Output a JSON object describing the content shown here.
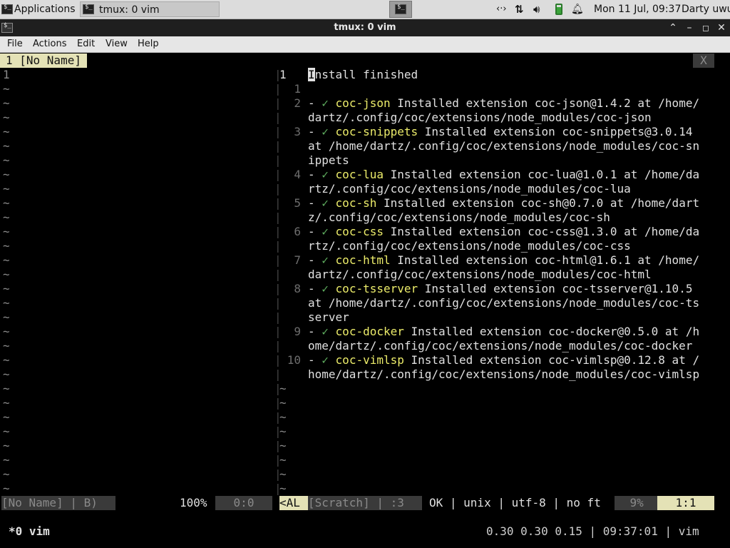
{
  "panel": {
    "apps_label": "Applications",
    "task_label": "tmux: 0 vim",
    "datetime": "Mon 11 Jul, 09:37",
    "user": "Darty uwu"
  },
  "window": {
    "title": "tmux: 0 vim"
  },
  "menu": [
    "File",
    "Actions",
    "Edit",
    "View",
    "Help"
  ],
  "vim": {
    "tab_label": "1 [No Name]",
    "tab_close": "X",
    "left_line": "1",
    "right_first_num": "1",
    "right_first_text": "Install finished",
    "right_second_num": "1",
    "entries": [
      {
        "num": "2",
        "name": "coc-json",
        "rest": " Installed extension coc-json@1.4.2 at /home/",
        "wrap": [
          "dartz/.config/coc/extensions/node_modules/coc-json"
        ]
      },
      {
        "num": "3",
        "name": "coc-snippets",
        "rest": " Installed extension coc-snippets@3.0.14",
        "wrap": [
          "at /home/dartz/.config/coc/extensions/node_modules/coc-sn",
          "ippets"
        ]
      },
      {
        "num": "4",
        "name": "coc-lua",
        "rest": " Installed extension coc-lua@1.0.1 at /home/da",
        "wrap": [
          "rtz/.config/coc/extensions/node_modules/coc-lua"
        ]
      },
      {
        "num": "5",
        "name": "coc-sh",
        "rest": " Installed extension coc-sh@0.7.0 at /home/dart",
        "wrap": [
          "z/.config/coc/extensions/node_modules/coc-sh"
        ]
      },
      {
        "num": "6",
        "name": "coc-css",
        "rest": " Installed extension coc-css@1.3.0 at /home/da",
        "wrap": [
          "rtz/.config/coc/extensions/node_modules/coc-css"
        ]
      },
      {
        "num": "7",
        "name": "coc-html",
        "rest": " Installed extension coc-html@1.6.1 at /home/",
        "wrap": [
          "dartz/.config/coc/extensions/node_modules/coc-html"
        ]
      },
      {
        "num": "8",
        "name": "coc-tsserver",
        "rest": " Installed extension coc-tsserver@1.10.5",
        "wrap": [
          "at /home/dartz/.config/coc/extensions/node_modules/coc-ts",
          "server"
        ]
      },
      {
        "num": "9",
        "name": "coc-docker",
        "rest": " Installed extension coc-docker@0.5.0 at /h",
        "wrap": [
          "ome/dartz/.config/coc/extensions/node_modules/coc-docker"
        ]
      },
      {
        "num": "10",
        "name": "coc-vimlsp",
        "rest": " Installed extension coc-vimlsp@0.12.8 at /",
        "wrap": [
          "home/dartz/.config/coc/extensions/node_modules/coc-vimlsp"
        ]
      }
    ],
    "bullet_prefix": "- ✓ ",
    "status": {
      "left_name": "[No Name] | B)",
      "left_pct": "100%",
      "left_pos": "0:0",
      "mid_mode": "<AL",
      "mid_scratch": "[Scratch] | :3",
      "mid_info": "OK | unix | utf-8 | no ft",
      "right_pct": "9%",
      "right_pos": "1:1"
    }
  },
  "tmux": {
    "window": "*0 vim",
    "right": "0.30 0.30 0.15 | 09:37:01 | vim"
  }
}
